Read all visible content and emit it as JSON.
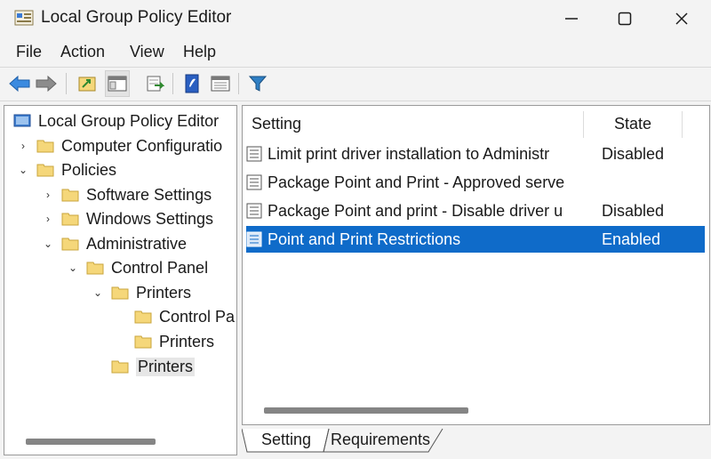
{
  "window": {
    "title": "Local Group Policy Editor",
    "controls": {
      "minimize": "minimize",
      "maximize": "maximize",
      "close": "close"
    }
  },
  "menu": [
    "File",
    "Action",
    "View",
    "Help"
  ],
  "toolbar": {
    "buttons": [
      "back-arrow-icon",
      "forward-arrow-icon",
      "folder-up-icon",
      "show-hide-tree-icon",
      "export-list-icon",
      "help-icon",
      "properties-icon",
      "filter-icon"
    ]
  },
  "tree": {
    "root": "Local Group Policy Editor",
    "items": [
      {
        "label": "Computer Configuratio",
        "chevron": "›"
      },
      {
        "label": "Policies",
        "chevron": "⌄"
      },
      {
        "label": "Software Settings",
        "chevron": "›"
      },
      {
        "label": "Windows Settings",
        "chevron": "›"
      },
      {
        "label": "Administrative",
        "chevron": "⌄"
      },
      {
        "label": "Control Panel",
        "chevron": "⌄"
      },
      {
        "label": "Printers",
        "chevron": "⌄"
      },
      {
        "label": "Control Pa",
        "chevron": ""
      },
      {
        "label": "Printers",
        "chevron": ""
      },
      {
        "label": "Printers",
        "chevron": ""
      }
    ]
  },
  "list": {
    "columns": {
      "setting": "Setting",
      "state": "State"
    },
    "rows": [
      {
        "name": "Limit print driver installation to Administr",
        "state": "Disabled"
      },
      {
        "name": "Package Point and Print - Approved serve",
        "state": ""
      },
      {
        "name": "Package Point and print - Disable driver u",
        "state": "Disabled"
      },
      {
        "name": "Point and Print Restrictions",
        "state": "Enabled"
      }
    ]
  },
  "tabs": [
    "Setting",
    "Requirements"
  ],
  "colors": {
    "selection": "#0f6bc9",
    "folder": "#f5d77a",
    "folder_border": "#c9a53c"
  }
}
